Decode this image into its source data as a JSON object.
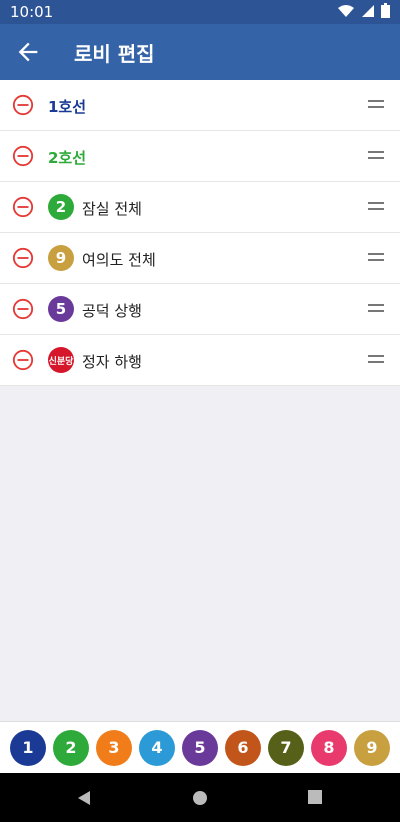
{
  "status": {
    "time": "10:01"
  },
  "appbar": {
    "title": "로비 편집"
  },
  "rows": [
    {
      "label": "1호선",
      "type": "line-header",
      "color": "#1a3a95"
    },
    {
      "label": "2호선",
      "type": "line-header",
      "color": "#2eaa3a"
    },
    {
      "badge": "2",
      "label": "잠실 전체",
      "color": "#2eaa3a"
    },
    {
      "badge": "9",
      "label": "여의도 전체",
      "color": "#c9a040"
    },
    {
      "badge": "5",
      "label": "공덕 상행",
      "color": "#6a3a9a"
    },
    {
      "badge": "신분당",
      "label": "정자 하행",
      "color": "#d6162a"
    }
  ],
  "lines": [
    {
      "label": "1",
      "color": "#1a3a95"
    },
    {
      "label": "2",
      "color": "#2eaa3a"
    },
    {
      "label": "3",
      "color": "#f07d1a"
    },
    {
      "label": "4",
      "color": "#2c9ad6"
    },
    {
      "label": "5",
      "color": "#6a3a9a"
    },
    {
      "label": "6",
      "color": "#c2561a"
    },
    {
      "label": "7",
      "color": "#566018"
    },
    {
      "label": "8",
      "color": "#e83a6d"
    },
    {
      "label": "9",
      "color": "#c9a040"
    }
  ]
}
